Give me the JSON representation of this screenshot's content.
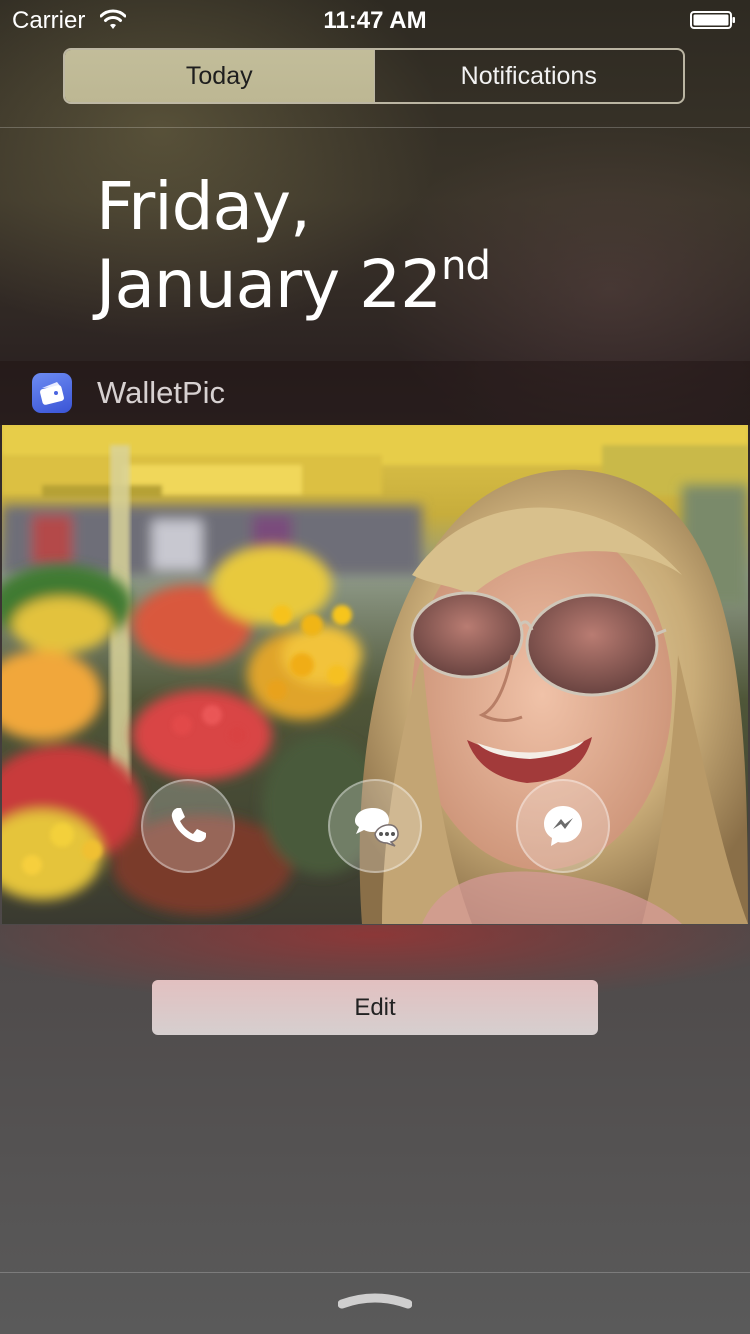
{
  "status_bar": {
    "carrier": "Carrier",
    "time": "11:47 AM"
  },
  "segmented": {
    "tabs": [
      {
        "label": "Today",
        "selected": true
      },
      {
        "label": "Notifications",
        "selected": false
      }
    ]
  },
  "date": {
    "weekday": "Friday,",
    "month_day": "January 22",
    "suffix": "nd"
  },
  "widget": {
    "app_name": "WalletPic",
    "icon": "wallet-icon",
    "actions": [
      {
        "name": "call",
        "icon": "phone-icon"
      },
      {
        "name": "message",
        "icon": "chat-bubbles-icon"
      },
      {
        "name": "messenger",
        "icon": "messenger-icon"
      }
    ]
  },
  "edit_label": "Edit",
  "colors": {
    "segment_selected": "#c2bd9a",
    "app_icon": "#4a64e0",
    "edit_button": "#dcc6c6"
  }
}
